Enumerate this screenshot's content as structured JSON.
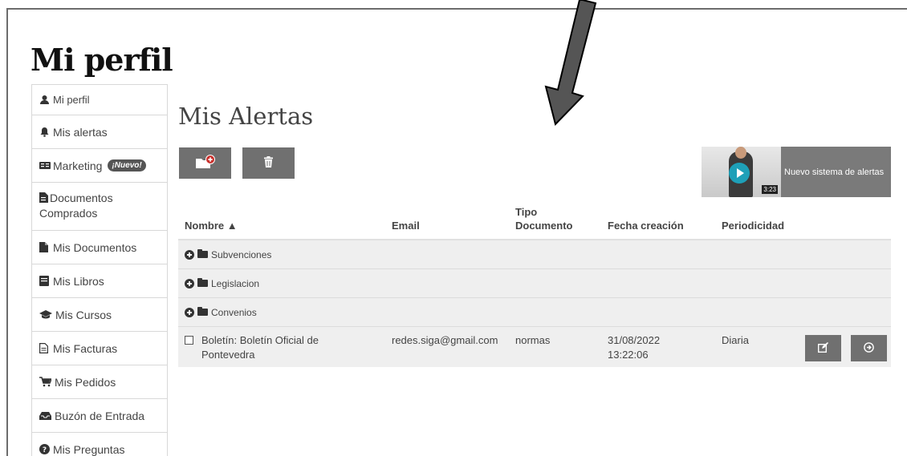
{
  "page": {
    "title": "Mi perfil"
  },
  "sidebar": {
    "items": [
      {
        "label": "Mi perfil",
        "icon": "user-icon"
      },
      {
        "label": "Mis alertas",
        "icon": "bell-icon"
      },
      {
        "label": "Marketing",
        "icon": "newspaper-icon",
        "badge": "¡Nuevo!"
      },
      {
        "label": "Documentos Comprados",
        "icon": "file-icon"
      },
      {
        "label": "Mis Documentos",
        "icon": "document-icon"
      },
      {
        "label": "Mis Libros",
        "icon": "book-icon"
      },
      {
        "label": "Mis Cursos",
        "icon": "graduation-cap-icon"
      },
      {
        "label": "Mis Facturas",
        "icon": "invoice-icon"
      },
      {
        "label": "Mis Pedidos",
        "icon": "cart-icon"
      },
      {
        "label": "Buzón de Entrada",
        "icon": "inbox-icon"
      },
      {
        "label": "Mis Preguntas",
        "icon": "question-icon"
      }
    ]
  },
  "main": {
    "title": "Mis Alertas",
    "video": {
      "label": "Nuevo sistema de alertas",
      "duration": "3:23"
    },
    "table": {
      "columns": [
        "Nombre ▲",
        "Email",
        "Tipo Documento",
        "Fecha creación",
        "Periodicidad"
      ],
      "groups": [
        "Subvenciones",
        "Legislacion",
        "Convenios"
      ],
      "rows": [
        {
          "nombre": "Boletín: Boletín Oficial de Pontevedra",
          "email": "redes.siga@gmail.com",
          "tipo": "normas",
          "fecha": "31/08/2022 13:22:06",
          "periodicidad": "Diaria"
        }
      ]
    }
  },
  "colors": {
    "button_bg": "#707070",
    "row_bg": "#efefef",
    "accent_play": "#1ea0b8"
  }
}
